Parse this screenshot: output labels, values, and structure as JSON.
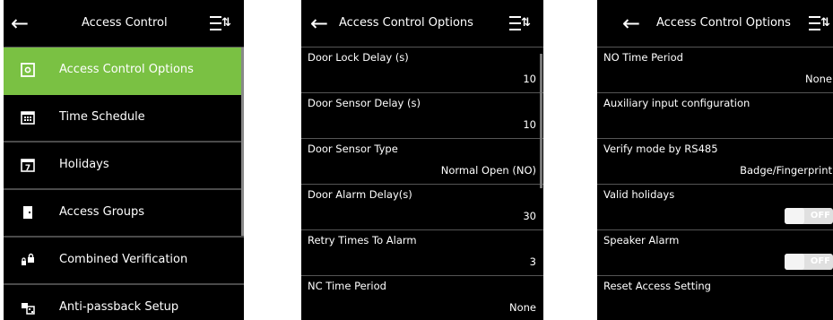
{
  "screen1": {
    "title": "Access Control",
    "items": [
      {
        "label": "Access Control Options",
        "icon": "door-options-icon",
        "active": true
      },
      {
        "label": "Time Schedule",
        "icon": "calendar-icon"
      },
      {
        "label": "Holidays",
        "icon": "holiday-calendar-icon"
      },
      {
        "label": "Access Groups",
        "icon": "door-icon"
      },
      {
        "label": "Combined Verification",
        "icon": "lock-group-icon"
      },
      {
        "label": "Anti-passback Setup",
        "icon": "anti-passback-icon"
      }
    ]
  },
  "screen2": {
    "title": "Access Control Options",
    "rows": [
      {
        "label": "Door Lock Delay (s)",
        "value": "10"
      },
      {
        "label": "Door Sensor Delay (s)",
        "value": "10"
      },
      {
        "label": "Door Sensor Type",
        "value": "Normal Open (NO)"
      },
      {
        "label": "Door Alarm Delay(s)",
        "value": "30"
      },
      {
        "label": "Retry Times To Alarm",
        "value": "3"
      },
      {
        "label": "NC Time Period",
        "value": "None"
      }
    ]
  },
  "screen3": {
    "title": "Access Control Options",
    "rows": [
      {
        "label": "NO Time Period",
        "value": "None"
      },
      {
        "label": "Auxiliary input configuration",
        "value": ""
      },
      {
        "label": "Verify mode by RS485",
        "value": "Badge/Fingerprint"
      },
      {
        "label": "Valid holidays",
        "toggle": "OFF"
      },
      {
        "label": "Speaker Alarm",
        "toggle": "OFF"
      },
      {
        "label": "Reset Access Setting",
        "value": ""
      }
    ]
  },
  "colors": {
    "accent": "#7ac143",
    "background": "#000000",
    "divider": "#555555"
  }
}
